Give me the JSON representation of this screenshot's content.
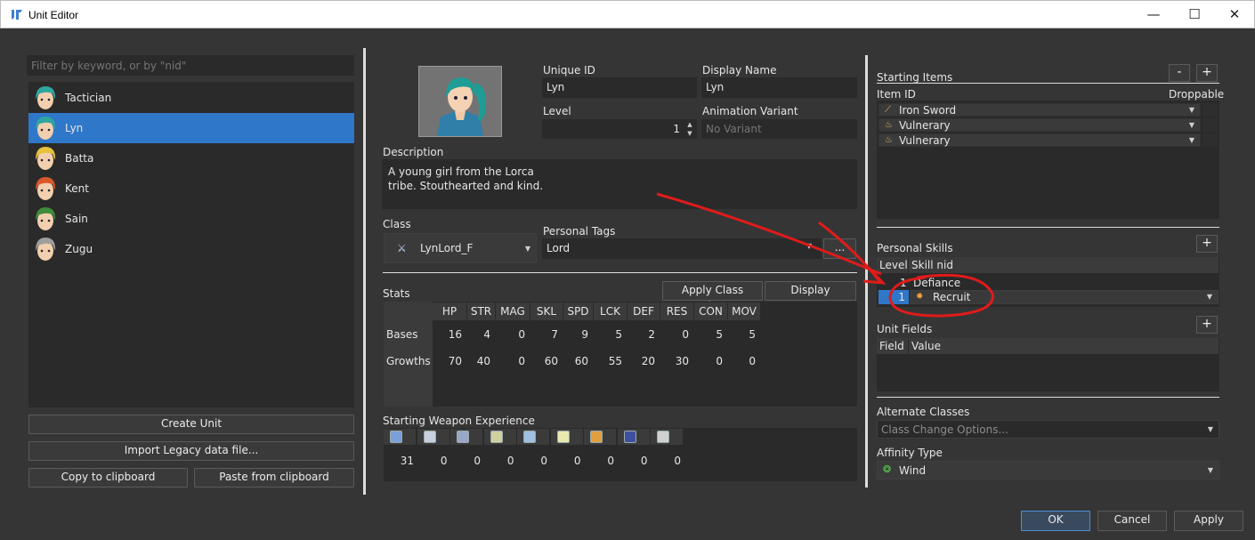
{
  "window": {
    "title": "Unit Editor",
    "minimize": "—",
    "maximize": "☐",
    "close": "✕"
  },
  "left": {
    "filter_placeholder": "Filter by keyword, or by \"nid\"",
    "units": [
      {
        "name": "Tactician",
        "hair": "#2fa6a0"
      },
      {
        "name": "Lyn",
        "hair": "#2fa6a0"
      },
      {
        "name": "Batta",
        "hair": "#e6c23c"
      },
      {
        "name": "Kent",
        "hair": "#d8582a"
      },
      {
        "name": "Sain",
        "hair": "#3f8c3a"
      },
      {
        "name": "Zugu",
        "hair": "#9e9e9e"
      }
    ],
    "selected": "Lyn",
    "create_unit": "Create Unit",
    "import_legacy": "Import Legacy data file...",
    "copy_clipboard": "Copy to clipboard",
    "paste_clipboard": "Paste from clipboard"
  },
  "middle": {
    "unique_id_label": "Unique ID",
    "unique_id": "Lyn",
    "display_name_label": "Display Name",
    "display_name": "Lyn",
    "level_label": "Level",
    "level": "1",
    "anim_label": "Animation Variant",
    "anim_placeholder": "No Variant",
    "description_label": "Description",
    "description": "A young girl from the Lorca\ntribe. Stouthearted and kind.",
    "class_label": "Class",
    "class_value": "LynLord_F",
    "tags_label": "Personal Tags",
    "tags_value": "Lord",
    "tags_more": "...",
    "stats_label": "Stats",
    "apply_class_values": "Apply Class Values",
    "display_averages": "Display Averages",
    "stat_headers": [
      "HP",
      "STR",
      "MAG",
      "SKL",
      "SPD",
      "LCK",
      "DEF",
      "RES",
      "CON",
      "MOV"
    ],
    "rows": [
      {
        "label": "Bases",
        "values": [
          "16",
          "4",
          "0",
          "7",
          "9",
          "5",
          "2",
          "0",
          "5",
          "5"
        ]
      },
      {
        "label": "Growths",
        "values": [
          "70",
          "40",
          "0",
          "60",
          "60",
          "55",
          "20",
          "30",
          "0",
          "0"
        ]
      }
    ],
    "wexp_label": "Starting Weapon Experience",
    "wexp_icons": [
      "sword-icon",
      "lance-icon",
      "axe-icon",
      "bow-icon",
      "staff-icon",
      "light-icon",
      "anima-icon",
      "dark-icon",
      "default-icon"
    ],
    "wexp_values": [
      "31",
      "0",
      "0",
      "0",
      "0",
      "0",
      "0",
      "0",
      "0"
    ]
  },
  "right": {
    "items_label": "Starting Items",
    "minus": "-",
    "plus": "+",
    "item_id_header": "Item ID",
    "droppable_header": "Droppable",
    "items": [
      "Iron Sword",
      "Vulnerary",
      "Vulnerary"
    ],
    "skills_label": "Personal Skills",
    "skill_headers": [
      "Level",
      "Skill nid"
    ],
    "skills": [
      {
        "level": "1",
        "nid": "Defiance"
      },
      {
        "level": "1",
        "nid": "Recruit"
      }
    ],
    "fields_label": "Unit Fields",
    "field_headers": [
      "Field",
      "Value"
    ],
    "alt_classes_label": "Alternate Classes",
    "alt_classes_placeholder": "Class Change Options...",
    "affinity_label": "Affinity Type",
    "affinity_value": "Wind"
  },
  "footer": {
    "ok": "OK",
    "cancel": "Cancel",
    "apply": "Apply"
  },
  "colors": {
    "selection": "#2f77c8",
    "annotation": "#e01b1b"
  }
}
